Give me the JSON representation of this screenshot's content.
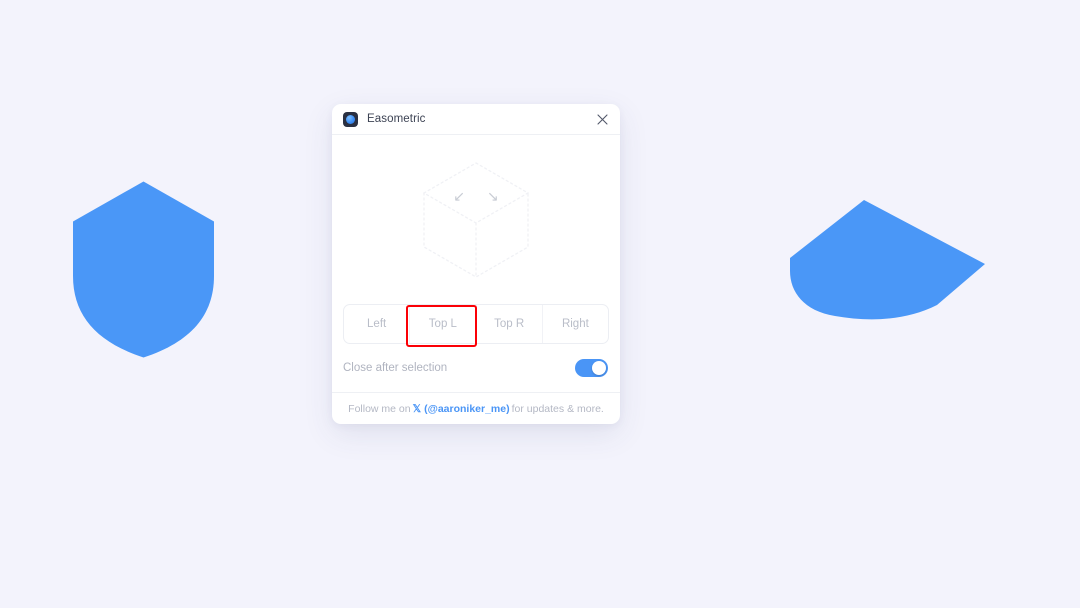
{
  "colors": {
    "page_background": "#f3f3fc",
    "shape_blue": "#4a97f7",
    "accent_blue": "#4a95f6",
    "focus_red": "#fb0006",
    "panel_background": "#ffffff"
  },
  "shapes": {
    "left": {
      "name": "shield",
      "fill": "#4a97f7"
    },
    "right": {
      "name": "shield-isometric-top-left",
      "fill": "#4a97f7"
    }
  },
  "panel": {
    "header": {
      "icon": "easometric-app-icon",
      "title": "Easometric",
      "close_icon": "close-icon"
    },
    "preview": {
      "cube_icon": "isometric-cube-outline",
      "arrow_left": "↙",
      "arrow_right": "↘"
    },
    "segmented_control": {
      "options": [
        {
          "label": "Left",
          "selected": false
        },
        {
          "label": "Top L",
          "selected": true
        },
        {
          "label": "Top R",
          "selected": false
        },
        {
          "label": "Right",
          "selected": false
        }
      ],
      "focused_index": 1
    },
    "toggle": {
      "label": "Close after selection",
      "state": "on"
    },
    "footer": {
      "prefix": "Follow me on",
      "x_icon": "x-logo-icon",
      "handle": "(@aaroniker_me)",
      "suffix": "for updates & more."
    }
  }
}
